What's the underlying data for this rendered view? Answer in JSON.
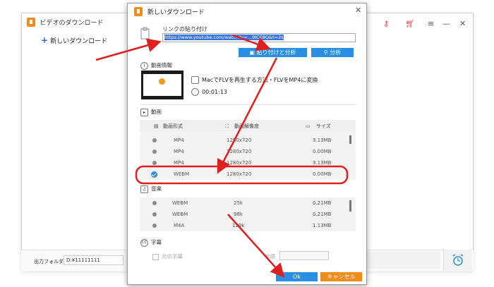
{
  "background_window": {
    "title": "ビデオのダウンロード",
    "new_download": "新しいダウンロード",
    "output_folder_label": "出力フォルダ：",
    "output_folder_value": "D:¥11111111"
  },
  "dialog": {
    "title": "新しいダウンロード",
    "paste_label": "リンクの貼り付け",
    "url_value": "https://www.youtube.com/watch?v=...9ICE8Q&t=2s",
    "paste_analyze_button": "貼り付けと分析",
    "analyze_button": "分析",
    "video_info_label": "動画情報",
    "video_title": "MacでFLVを再生する方法・FLVをMP4に変換",
    "duration": "00:01:13",
    "video_section_label": "動画",
    "video_table": {
      "headers": [
        "動画形式",
        "動画解像度",
        "サイズ"
      ],
      "rows": [
        {
          "format": "MP4",
          "resolution": "1280x720",
          "size": "3.13MB",
          "selected": false
        },
        {
          "format": "MP4",
          "resolution": "1280x720",
          "size": "0.00MB",
          "selected": false
        },
        {
          "format": "MP4",
          "resolution": "1280x720",
          "size": "3.13MB",
          "selected": false
        },
        {
          "format": "WEBM",
          "resolution": "1280x720",
          "size": "0.00MB",
          "selected": true
        }
      ]
    },
    "audio_section_label": "音楽",
    "audio_table": {
      "rows": [
        {
          "format": "WEBM",
          "bitrate": "25k",
          "size": "0.21MB"
        },
        {
          "format": "WEBM",
          "bitrate": "98k",
          "size": "0.21MB"
        },
        {
          "format": "M4A",
          "bitrate": "129k",
          "size": "1.13MB"
        }
      ]
    },
    "subtitle_section_label": "字幕",
    "original_subtitle_label": "元の字幕",
    "language_label": "言語",
    "ok_button": "Ok",
    "cancel_button": "キャンセル"
  },
  "colors": {
    "accent_blue": "#2a8ee3",
    "accent_orange": "#f08c1a",
    "annotation_red": "#e02020"
  },
  "icons": [
    "app-icon",
    "clipboard-icon",
    "search-icon",
    "info-icon",
    "film-icon",
    "clock-icon",
    "music-icon",
    "cc-icon",
    "key-icon",
    "cart-icon",
    "alarm-icon"
  ]
}
